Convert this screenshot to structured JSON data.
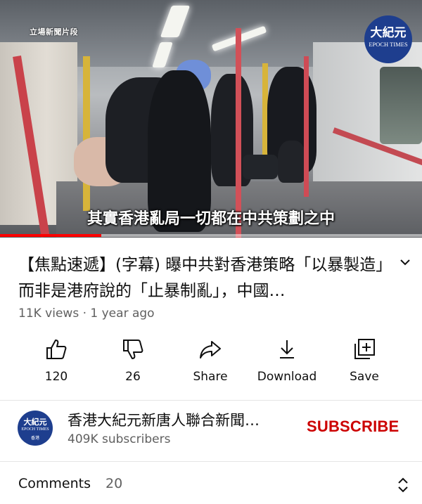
{
  "video": {
    "source_label": "立場新聞片段",
    "logo": {
      "chinese": "大紀元",
      "english": "EPOCH TIMES"
    },
    "subtitle": "其實香港亂局一切都在中共策劃之中",
    "progress_fraction": 0.24,
    "progress_color": "#ff0000"
  },
  "title": {
    "text": "【焦點速遞】(字幕) 曝中共對香港策略「以暴製造」而非是港府說的「止暴制亂」，中國…",
    "expand_icon": "chevron-down-icon"
  },
  "meta": {
    "views": "11K views",
    "separator": "·",
    "age": "1 year ago"
  },
  "actions": [
    {
      "icon": "thumbs-up-icon",
      "label": "120"
    },
    {
      "icon": "thumbs-down-icon",
      "label": "26"
    },
    {
      "icon": "share-icon",
      "label": "Share"
    },
    {
      "icon": "download-icon",
      "label": "Download"
    },
    {
      "icon": "save-to-playlist-icon",
      "label": "Save"
    }
  ],
  "channel": {
    "avatar": {
      "chinese": "大紀元",
      "english": "EPOCH TIMES",
      "sub": "香港"
    },
    "name": "香港大紀元新唐人聯合新聞…",
    "subscribers": "409K subscribers",
    "subscribe_label": "SUBSCRIBE",
    "subscribe_color": "#cc0000"
  },
  "comments": {
    "label": "Comments",
    "count": "20",
    "toggle_icon": "expand-collapse-icon"
  }
}
